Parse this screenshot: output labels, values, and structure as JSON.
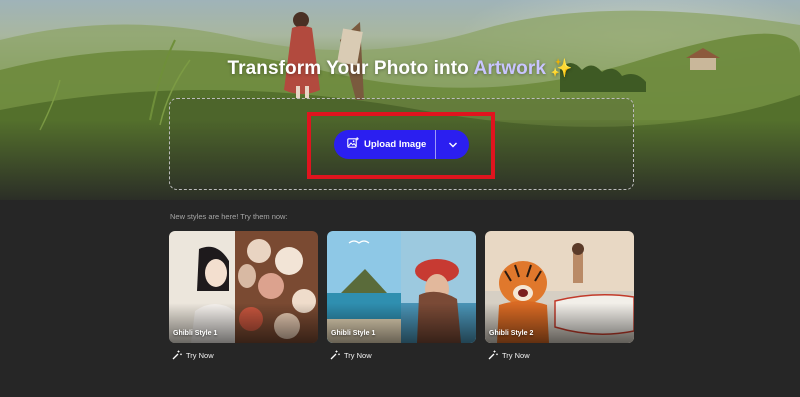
{
  "hero": {
    "title_prefix": "Transform Your Photo into ",
    "title_accent": "Artwork",
    "sparkle": "✨"
  },
  "upload": {
    "label": "Upload Image",
    "icon": "image-add-icon",
    "dropdown_icon": "chevron-down-icon"
  },
  "styles": {
    "caption": "New styles are here! Try them now:",
    "cards": [
      {
        "label": "Ghibli Style 1",
        "action": "Try Now"
      },
      {
        "label": "Ghibli Style 1",
        "action": "Try Now"
      },
      {
        "label": "Ghibli Style 2",
        "action": "Try Now"
      }
    ]
  },
  "colors": {
    "primary_button": "#2b1ff0",
    "highlight_box": "#e0141e",
    "accent_text": "#c9c5ff",
    "background": "#262626"
  }
}
